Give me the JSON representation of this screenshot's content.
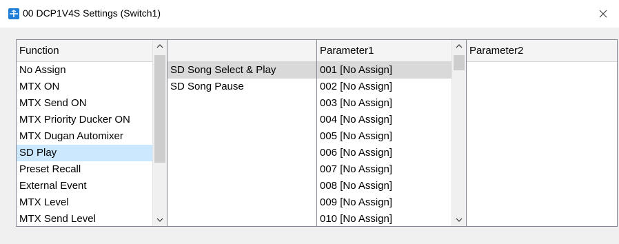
{
  "window": {
    "title": "00 DCP1V4S Settings (Switch1)",
    "close_label": "×"
  },
  "function_list": {
    "header": "Function",
    "items": [
      "No Assign",
      "MTX ON",
      "MTX Send ON",
      "MTX Priority Ducker ON",
      "MTX Dugan Automixer",
      "SD Play",
      "Preset Recall",
      "External Event",
      "MTX Level",
      "MTX Send Level"
    ],
    "selected": "SD Play"
  },
  "sub_list": {
    "header": "",
    "items": [
      "SD Song Select & Play",
      "SD Song Pause"
    ],
    "selected": "SD Song Select & Play"
  },
  "parameter1": {
    "header": "Parameter1",
    "items": [
      "001 [No Assign]",
      "002 [No Assign]",
      "003 [No Assign]",
      "004 [No Assign]",
      "005 [No Assign]",
      "006 [No Assign]",
      "007 [No Assign]",
      "008 [No Assign]",
      "009 [No Assign]",
      "010 [No Assign]"
    ],
    "selected": "001 [No Assign]"
  },
  "parameter2": {
    "header": "Parameter2",
    "items": []
  },
  "icons": {
    "app": "app-icon",
    "close": "close-icon",
    "scroll_up": "chevron-up-icon",
    "scroll_down": "chevron-down-icon"
  },
  "colors": {
    "selection_blue": "#cce8ff",
    "selection_gray": "#d9d9d9",
    "app_icon": "#1f7fd8"
  }
}
